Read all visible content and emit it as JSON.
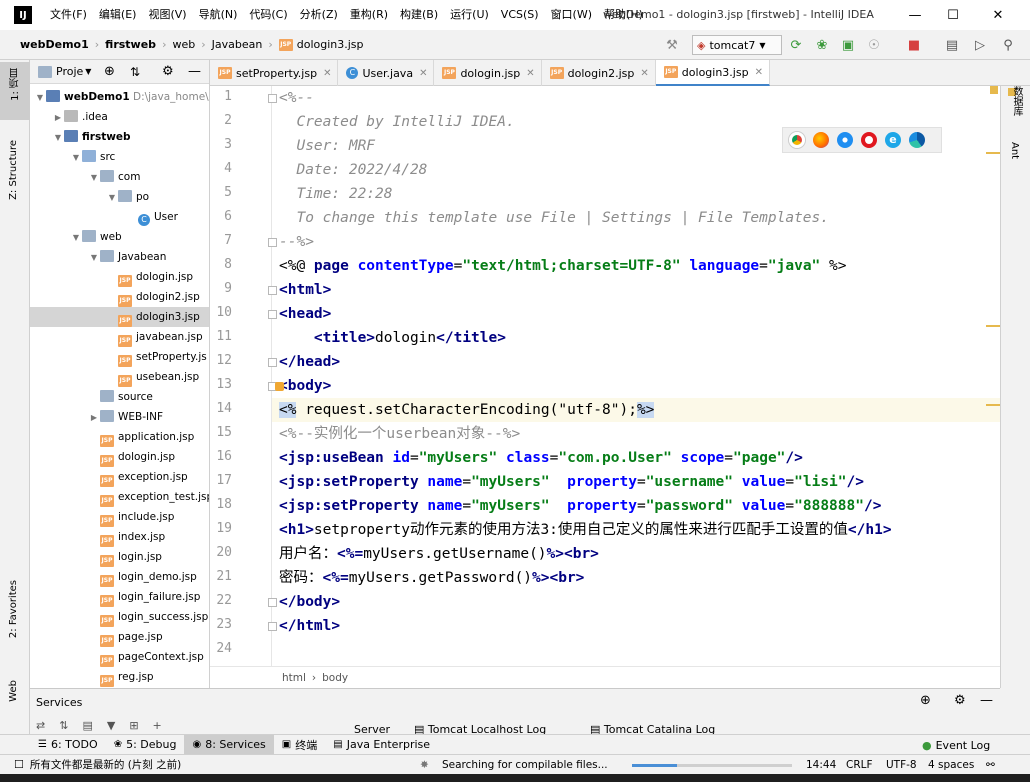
{
  "window": {
    "title": "webDemo1 - dologin3.jsp [firstweb] - IntelliJ IDEA",
    "menu": [
      "文件(F)",
      "编辑(E)",
      "视图(V)",
      "导航(N)",
      "代码(C)",
      "分析(Z)",
      "重构(R)",
      "构建(B)",
      "运行(U)",
      "VCS(S)",
      "窗口(W)",
      "帮助(H)"
    ]
  },
  "breadcrumb": [
    "webDemo1",
    "firstweb",
    "web",
    "Javabean",
    "dologin3.jsp"
  ],
  "run_config": "tomcat7",
  "left_stripe": {
    "project": "1: 项目",
    "structure": "Z: Structure",
    "favorites": "2: Favorites",
    "web": "Web"
  },
  "right_stripe": {
    "database": "数据库",
    "ant": "Ant"
  },
  "project_panel": {
    "title": "Proje",
    "tree": [
      {
        "label": "webDemo1",
        "hint": "D:\\java_home\\we",
        "type": "module",
        "depth": 0,
        "expanded": true,
        "bold": true
      },
      {
        "label": ".idea",
        "type": "folder-idea",
        "depth": 1,
        "expanded": false
      },
      {
        "label": "firstweb",
        "type": "module",
        "depth": 1,
        "expanded": true,
        "bold": true
      },
      {
        "label": "src",
        "type": "folder-src",
        "depth": 2,
        "expanded": true
      },
      {
        "label": "com",
        "type": "folder",
        "depth": 3,
        "expanded": true
      },
      {
        "label": "po",
        "type": "folder",
        "depth": 4,
        "expanded": true
      },
      {
        "label": "User",
        "type": "class",
        "depth": 5,
        "expanded": false
      },
      {
        "label": "web",
        "type": "folder",
        "depth": 2,
        "expanded": true
      },
      {
        "label": "Javabean",
        "type": "folder",
        "depth": 3,
        "expanded": true
      },
      {
        "label": "dologin.jsp",
        "type": "jsp",
        "depth": 4
      },
      {
        "label": "dologin2.jsp",
        "type": "jsp",
        "depth": 4
      },
      {
        "label": "dologin3.jsp",
        "type": "jsp",
        "depth": 4,
        "selected": true
      },
      {
        "label": "javabean.jsp",
        "type": "jsp",
        "depth": 4
      },
      {
        "label": "setProperty.js",
        "type": "jsp",
        "depth": 4
      },
      {
        "label": "usebean.jsp",
        "type": "jsp",
        "depth": 4
      },
      {
        "label": "source",
        "type": "folder",
        "depth": 3
      },
      {
        "label": "WEB-INF",
        "type": "folder",
        "depth": 3,
        "expanded": false
      },
      {
        "label": "application.jsp",
        "type": "jsp",
        "depth": 3
      },
      {
        "label": "dologin.jsp",
        "type": "jsp",
        "depth": 3
      },
      {
        "label": "exception.jsp",
        "type": "jsp",
        "depth": 3
      },
      {
        "label": "exception_test.jsp",
        "type": "jsp",
        "depth": 3
      },
      {
        "label": "include.jsp",
        "type": "jsp",
        "depth": 3
      },
      {
        "label": "index.jsp",
        "type": "jsp",
        "depth": 3
      },
      {
        "label": "login.jsp",
        "type": "jsp",
        "depth": 3
      },
      {
        "label": "login_demo.jsp",
        "type": "jsp",
        "depth": 3
      },
      {
        "label": "login_failure.jsp",
        "type": "jsp",
        "depth": 3
      },
      {
        "label": "login_success.jsp",
        "type": "jsp",
        "depth": 3
      },
      {
        "label": "page.jsp",
        "type": "jsp",
        "depth": 3
      },
      {
        "label": "pageContext.jsp",
        "type": "jsp",
        "depth": 3
      },
      {
        "label": "reg.jsp",
        "type": "jsp",
        "depth": 3
      }
    ]
  },
  "editor_tabs": [
    {
      "label": "setProperty.jsp",
      "icon": "jsp"
    },
    {
      "label": "User.java",
      "icon": "class"
    },
    {
      "label": "dologin.jsp",
      "icon": "jsp"
    },
    {
      "label": "dologin2.jsp",
      "icon": "jsp"
    },
    {
      "label": "dologin3.jsp",
      "icon": "jsp",
      "active": true
    }
  ],
  "code_lines": [
    [
      [
        "c-comment",
        "<%--"
      ]
    ],
    [
      [
        "c-comment",
        "  Created by IntelliJ IDEA."
      ]
    ],
    [
      [
        "c-comment",
        "  User: MRF"
      ]
    ],
    [
      [
        "c-comment",
        "  Date: 2022/4/28"
      ]
    ],
    [
      [
        "c-comment",
        "  Time: 22:28"
      ]
    ],
    [
      [
        "c-comment",
        "  To change this template use File | Settings | File Templates."
      ]
    ],
    [
      [
        "c-comment",
        "--%>"
      ]
    ],
    [
      [
        "",
        "<%@ "
      ],
      [
        "c-tag",
        "page"
      ],
      [
        "",
        " "
      ],
      [
        "c-attr",
        "contentType"
      ],
      [
        "",
        "="
      ],
      [
        "c-val",
        "\"text/html;charset=UTF-8\""
      ],
      [
        "",
        " "
      ],
      [
        "c-attr",
        "language"
      ],
      [
        "",
        "="
      ],
      [
        "c-val",
        "\"java\""
      ],
      [
        "",
        " %>"
      ]
    ],
    [
      [
        "c-tag",
        "<html>"
      ]
    ],
    [
      [
        "c-tag",
        "<head>"
      ]
    ],
    [
      [
        "",
        "    "
      ],
      [
        "c-tag",
        "<title>"
      ],
      [
        "",
        "dologin"
      ],
      [
        "c-tag",
        "</title>"
      ]
    ],
    [
      [
        "c-tag",
        "</head>"
      ]
    ],
    [
      [
        "c-tag",
        "<body>"
      ]
    ],
    [
      [
        "c-hl",
        "<%"
      ],
      [
        "",
        " request.setCharacterEncoding(\"utf-8\");"
      ],
      [
        "c-hl",
        "%>"
      ]
    ],
    [
      [
        "c-gray",
        "<%--实例化一个userbean对象--%>"
      ]
    ],
    [
      [
        "c-tag",
        "<jsp:useBean "
      ],
      [
        "c-attr",
        "id"
      ],
      [
        "",
        "="
      ],
      [
        "c-val",
        "\"myUsers\""
      ],
      [
        "",
        " "
      ],
      [
        "c-attr",
        "class"
      ],
      [
        "",
        "="
      ],
      [
        "c-val",
        "\"com.po.User\""
      ],
      [
        "",
        " "
      ],
      [
        "c-attr",
        "scope"
      ],
      [
        "",
        "="
      ],
      [
        "c-val",
        "\"page\""
      ],
      [
        "c-tag",
        "/>"
      ]
    ],
    [
      [
        "c-tag",
        "<jsp:setProperty "
      ],
      [
        "c-attr",
        "name"
      ],
      [
        "",
        "="
      ],
      [
        "c-val",
        "\"myUsers\""
      ],
      [
        "",
        "  "
      ],
      [
        "c-attr",
        "property"
      ],
      [
        "",
        "="
      ],
      [
        "c-val",
        "\"username\""
      ],
      [
        "",
        " "
      ],
      [
        "c-attr",
        "value"
      ],
      [
        "",
        "="
      ],
      [
        "c-val",
        "\"lisi\""
      ],
      [
        "c-tag",
        "/>"
      ]
    ],
    [
      [
        "c-tag",
        "<jsp:setProperty "
      ],
      [
        "c-attr",
        "name"
      ],
      [
        "",
        "="
      ],
      [
        "c-val",
        "\"myUsers\""
      ],
      [
        "",
        "  "
      ],
      [
        "c-attr",
        "property"
      ],
      [
        "",
        "="
      ],
      [
        "c-val",
        "\"password\""
      ],
      [
        "",
        " "
      ],
      [
        "c-attr",
        "value"
      ],
      [
        "",
        "="
      ],
      [
        "c-val",
        "\"888888\""
      ],
      [
        "c-tag",
        "/>"
      ]
    ],
    [
      [
        "c-tag",
        "<h1>"
      ],
      [
        "",
        "setproperty动作元素的使用方法3:使用自己定义的属性来进行匹配手工设置的值"
      ],
      [
        "c-tag",
        "</h1>"
      ]
    ],
    [
      [
        "",
        "用户名："
      ],
      [
        "c-tag",
        "<%="
      ],
      [
        "",
        "myUsers.getUsername()"
      ],
      [
        "c-tag",
        "%><br>"
      ]
    ],
    [
      [
        "",
        "密码："
      ],
      [
        "c-tag",
        "<%="
      ],
      [
        "",
        "myUsers.getPassword()"
      ],
      [
        "c-tag",
        "%><br>"
      ]
    ],
    [
      [
        "c-tag",
        "</body>"
      ]
    ],
    [
      [
        "c-tag",
        "</html>"
      ]
    ],
    [
      [
        "",
        ""
      ]
    ]
  ],
  "current_line": 14,
  "editor_breadcrumb": [
    "html",
    "body"
  ],
  "services": {
    "title": "Services",
    "tabs": [
      "Server",
      "Tomcat Localhost Log",
      "Tomcat Catalina Log"
    ]
  },
  "bottom_tools": [
    {
      "label": "6: TODO",
      "icon": "list-icon"
    },
    {
      "label": "5: Debug",
      "icon": "bug-icon"
    },
    {
      "label": "8: Services",
      "icon": "services-icon",
      "active": true
    },
    {
      "label": "终端",
      "icon": "terminal-icon"
    },
    {
      "label": "Java Enterprise",
      "icon": "java-enterprise-icon"
    }
  ],
  "event_log": "Event Log",
  "status": {
    "message": "所有文件都是最新的 (片刻 之前)",
    "task": "Searching for compilable files...",
    "position": "14:44",
    "line_ending": "CRLF",
    "encoding": "UTF-8",
    "indent": "4 spaces",
    "progress": 0.28
  },
  "colors": {
    "accent": "#4083c9",
    "tag": "#000080",
    "attr": "#0000ff",
    "string": "#067d17",
    "comment": "#8c8c8c",
    "current_line": "#fcf9e8"
  }
}
